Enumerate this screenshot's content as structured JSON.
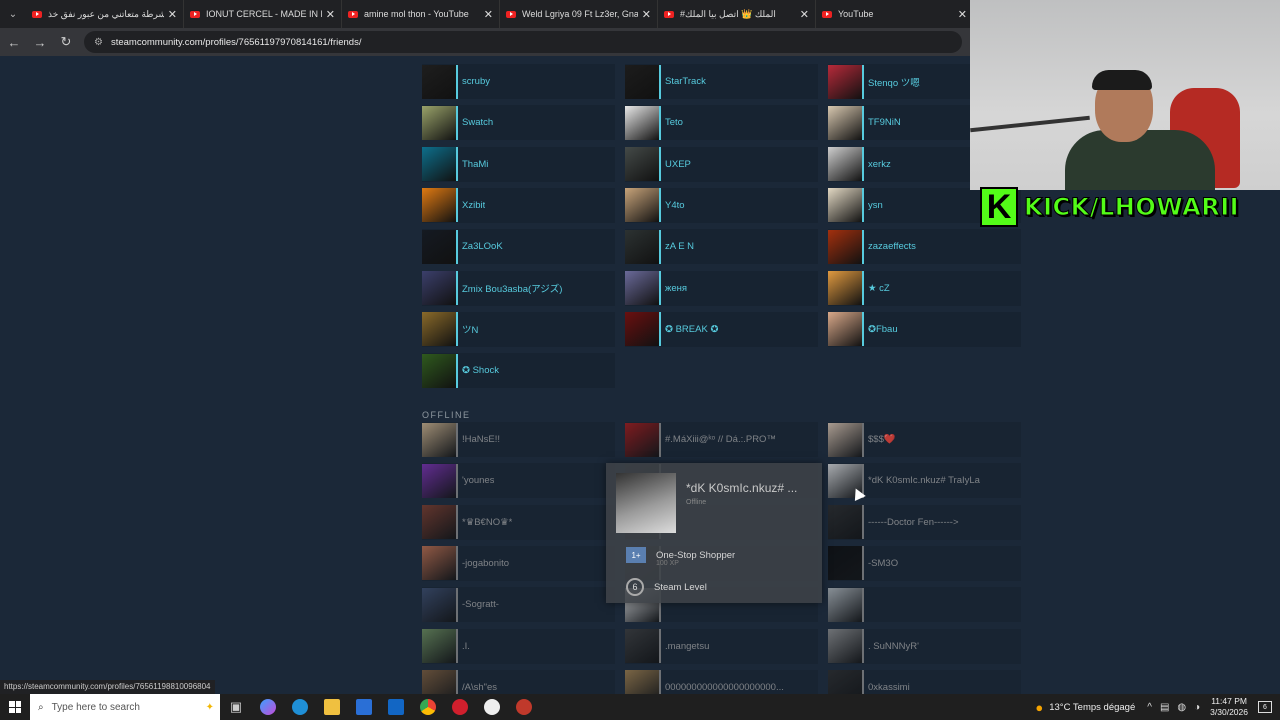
{
  "browser": {
    "tabs": [
      {
        "title": "الشرطة متعاتني من عبور نفق خذ"
      },
      {
        "title": "IONUT CERCEL - MADE IN RO"
      },
      {
        "title": "amine mol thon - YouTube"
      },
      {
        "title": "Weld Lgriya 09 Ft Lz3er, Gnawi"
      },
      {
        "title": "#الملك 👑 اتصل بيا الملك"
      },
      {
        "title": "YouTube"
      }
    ],
    "url": "steamcommunity.com/profiles/76561197970814161/friends/",
    "status_url": "https://steamcommunity.com/profiles/76561198810096804"
  },
  "overlay": {
    "kick_text": "KICK/LHOWARII",
    "kick_logo": "K"
  },
  "friends": {
    "offline_label": "OFFLINE",
    "online": [
      {
        "name": "scruby",
        "color": "#1e1e1e"
      },
      {
        "name": "StarTrack",
        "color": "#1c1c1c"
      },
      {
        "name": "Stenqo ツ嗯",
        "color": "#b72a3a"
      },
      {
        "name": "Swatch",
        "color": "#9aa36a"
      },
      {
        "name": "Teto",
        "color": "#e9e9e9"
      },
      {
        "name": "TF9NiN",
        "color": "#d8c8b0"
      },
      {
        "name": "ThaMi",
        "color": "#0d6f8c"
      },
      {
        "name": "UXEP",
        "color": "#444a48"
      },
      {
        "name": "xerkz",
        "color": "#cfcfcf"
      },
      {
        "name": "Xzibit",
        "color": "#e07a12"
      },
      {
        "name": "Y4to",
        "color": "#c8a47a"
      },
      {
        "name": "ysn",
        "color": "#e3d9c4"
      },
      {
        "name": "Za3LOoK",
        "color": "#151a22"
      },
      {
        "name": "zA E N",
        "color": "#2c3232"
      },
      {
        "name": "zazaeffects",
        "color": "#a3300e"
      },
      {
        "name": "Zmix Bou3asba(アジズ)",
        "color": "#3b3f6b"
      },
      {
        "name": "женя",
        "color": "#6a6a9a"
      },
      {
        "name": "★ cZ",
        "color": "#e09a40"
      },
      {
        "name": "ツN",
        "color": "#8a6a2a"
      },
      {
        "name": "✪ BREAK ✪",
        "color": "#6a1010"
      },
      {
        "name": "✪Fbau",
        "color": "#d9a98a"
      },
      {
        "name": "✪ Shock",
        "color": "#2f5a1e"
      }
    ],
    "offline": [
      {
        "name": "!HaNsE!!",
        "color": "#cbb08a"
      },
      {
        "name": "#.MáXiii@ᵏᵒ // Dá.:.PRO™",
        "color": "#a01818"
      },
      {
        "name": "$$$❤️",
        "color": "#d8c2ae"
      },
      {
        "name": "'younes",
        "color": "#7a2fb0"
      },
      {
        "name": "",
        "color": "#2a2a2a"
      },
      {
        "name": "*dK K0smIc.nkuz# TraIyLa",
        "color": "#d9d9d9"
      },
      {
        "name": "*♛B€NO♛*",
        "color": "#7a3a2a"
      },
      {
        "name": "",
        "color": "#2a2a2a"
      },
      {
        "name": "------Doctor Fen------>",
        "color": "#2a2a2a"
      },
      {
        "name": "-jogabonito",
        "color": "#b86a4a"
      },
      {
        "name": "",
        "color": "#2a2a2a"
      },
      {
        "name": "-SM3O",
        "color": "#0a0a0a"
      },
      {
        "name": "-Sogratt-",
        "color": "#3a4a6a"
      },
      {
        "name": "",
        "color": "#eeeeee"
      },
      {
        "name": "",
        "color": "#aeb4b8"
      },
      {
        "name": ".I.",
        "color": "#6a8a5a"
      },
      {
        "name": ".mangetsu",
        "color": "#3a3a3a"
      },
      {
        "name": ". SuNNNyR'",
        "color": "#8a8a8a"
      },
      {
        "name": "/A\\sh\"es",
        "color": "#7a5a3a"
      },
      {
        "name": "000000000000000000000...",
        "color": "#9a7a4a"
      },
      {
        "name": "0xkassimi",
        "color": "#2a2a2a"
      }
    ]
  },
  "popup": {
    "name": "*dK K0smIc.nkuz# ...",
    "status": "Offline",
    "badge_icon": "1+",
    "badge_name": "One-Stop Shopper",
    "badge_xp": "100 XP",
    "level": "6",
    "level_label": "Steam Level"
  },
  "taskbar": {
    "search_placeholder": "Type here to search",
    "weather": "13°C  Temps dégagé",
    "time": "11:47 PM",
    "date": "3/30/2026",
    "notif_count": "6"
  }
}
